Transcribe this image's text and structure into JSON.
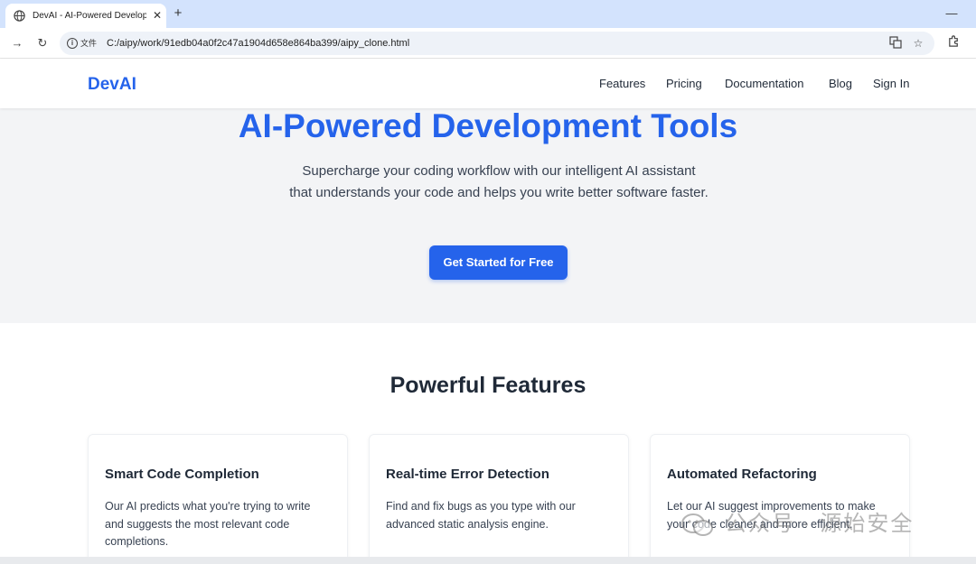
{
  "browser": {
    "tab_title": "DevAI - AI-Powered Develop",
    "file_chip": "文件",
    "url": "C:/aipy/work/91edb04a0f2c47a1904d658e864ba399/aipy_clone.html",
    "icons": {
      "favicon": "globe-icon",
      "close": "close-icon",
      "new_tab": "plus-icon",
      "minimize": "minimize-icon",
      "back": "arrow-left-icon",
      "reload": "reload-icon",
      "info": "info-icon",
      "translate": "translate-icon",
      "bookmark": "star-icon",
      "extensions": "puzzle-icon"
    }
  },
  "header": {
    "logo": "DevAI",
    "nav": [
      {
        "label": "Features"
      },
      {
        "label": "Pricing"
      },
      {
        "label": "Documentation"
      },
      {
        "label": "Blog"
      },
      {
        "label": "Sign In"
      }
    ]
  },
  "hero": {
    "title": "AI-Powered Development Tools",
    "subtitle": "Supercharge your coding workflow with our intelligent AI assistant that understands your code and helps you write better software faster.",
    "cta": "Get Started for Free"
  },
  "features": {
    "title": "Powerful Features",
    "items": [
      {
        "title": "Smart Code Completion",
        "description": "Our AI predicts what you're trying to write and suggests the most relevant code completions."
      },
      {
        "title": "Real-time Error Detection",
        "description": "Find and fix bugs as you type with our advanced static analysis engine."
      },
      {
        "title": "Automated Refactoring",
        "description": "Let our AI suggest improvements to make your code cleaner and more efficient."
      }
    ]
  },
  "watermark": {
    "text": "公众号 · 源始安全"
  },
  "colors": {
    "brand": "#2563eb",
    "hero_bg": "#f3f4f6",
    "chrome_tab_strip": "#d3e3fd"
  }
}
